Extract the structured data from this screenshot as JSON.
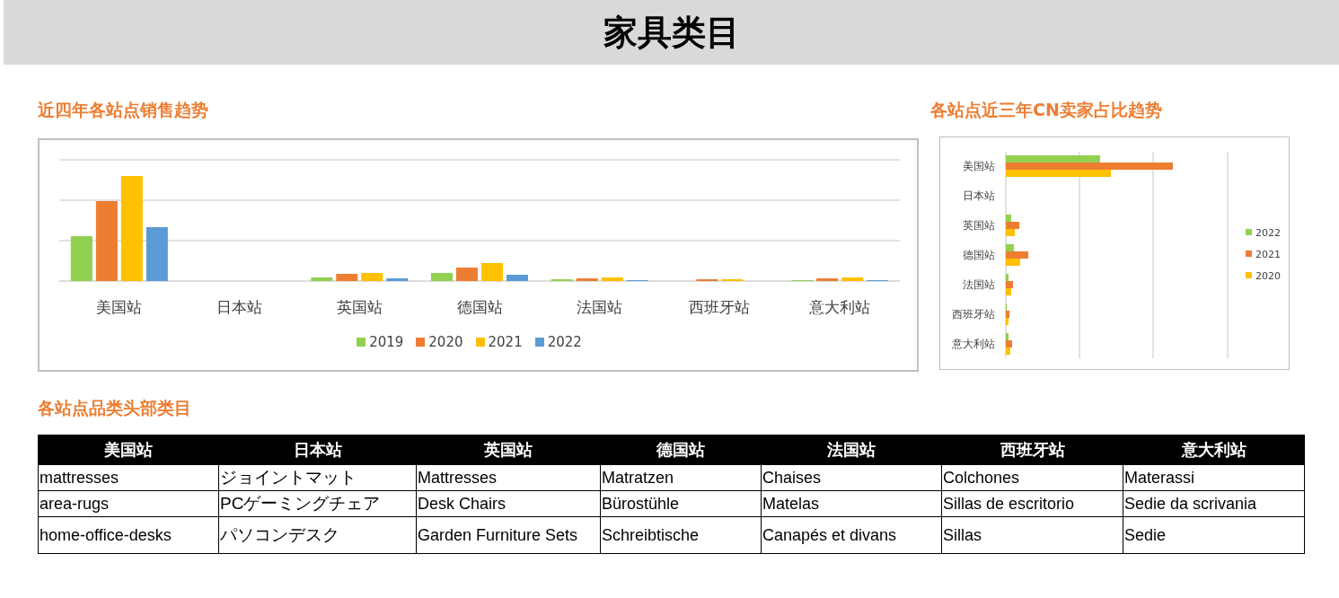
{
  "title": "家具类目",
  "sales_chart": {
    "title": "近四年各站点销售趋势",
    "categories": [
      "美国站",
      "日本站",
      "英国站",
      "德国站",
      "法国站",
      "西班牙站",
      "意大利站"
    ],
    "legend": [
      {
        "label": "2019",
        "color": "#92d050"
      },
      {
        "label": "2020",
        "color": "#ed7d31"
      },
      {
        "label": "2021",
        "color": "#ffc000"
      },
      {
        "label": "2022",
        "color": "#5b9bd5"
      }
    ]
  },
  "cn_chart": {
    "title": "各站点近三年CN卖家占比趋势",
    "categories": [
      "美国站",
      "日本站",
      "英国站",
      "德国站",
      "法国站",
      "西班牙站",
      "意大利站"
    ],
    "legend": [
      {
        "label": "2022",
        "color": "#92d050"
      },
      {
        "label": "2021",
        "color": "#ed7d31"
      },
      {
        "label": "2020",
        "color": "#ffc000"
      }
    ]
  },
  "table_section": {
    "title": "各站点品类头部类目",
    "columns": [
      "美国站",
      "日本站",
      "英国站",
      "德国站",
      "法国站",
      "西班牙站",
      "意大利站"
    ],
    "rows": [
      [
        "mattresses",
        "ジョイントマット",
        "Mattresses",
        "Matratzen",
        "Chaises",
        "Colchones",
        "Materassi"
      ],
      [
        "area-rugs",
        "PCゲーミングチェア",
        "Desk Chairs",
        "Bürostühle",
        "Matelas",
        "Sillas de escritorio",
        "Sedie da scrivania"
      ],
      [
        "home-office-desks",
        "パソコンデスク",
        "Garden Furniture Sets",
        "Schreibtische",
        "Canapés et divans",
        "Sillas",
        "Sedie"
      ]
    ]
  }
}
